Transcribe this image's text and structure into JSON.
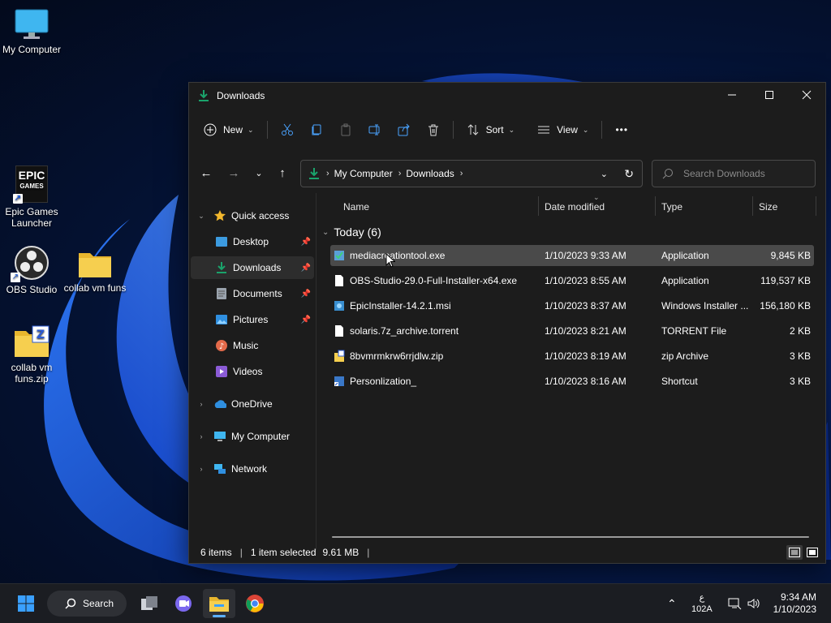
{
  "desktop": {
    "icons": [
      {
        "label": "My Computer"
      },
      {
        "label": "Epic Games Launcher"
      },
      {
        "label": "OBS Studio"
      },
      {
        "label": "collab vm funs"
      },
      {
        "label": "collab vm funs.zip"
      }
    ],
    "epic_logo_text": [
      "EPIC",
      "GAMES"
    ]
  },
  "window": {
    "title": "Downloads",
    "toolbar": {
      "new_label": "New",
      "sort_label": "Sort",
      "view_label": "View",
      "more_label": "•••"
    },
    "address": {
      "crumbs": [
        "My Computer",
        "Downloads"
      ]
    },
    "search": {
      "placeholder": "Search Downloads"
    },
    "nav": {
      "quick_access": "Quick access",
      "items": [
        {
          "label": "Desktop",
          "pinned": true
        },
        {
          "label": "Downloads",
          "pinned": true,
          "selected": true
        },
        {
          "label": "Documents",
          "pinned": true
        },
        {
          "label": "Pictures",
          "pinned": true
        },
        {
          "label": "Music",
          "pinned": false
        },
        {
          "label": "Videos",
          "pinned": false
        }
      ],
      "onedrive": "OneDrive",
      "my_computer": "My Computer",
      "network": "Network"
    },
    "columns": {
      "name": "Name",
      "date": "Date modified",
      "type": "Type",
      "size": "Size"
    },
    "group": {
      "label": "Today (6)"
    },
    "files": [
      {
        "name": "mediacreationtool.exe",
        "date": "1/10/2023 9:33 AM",
        "type": "Application",
        "size": "9,845 KB",
        "icon": "installer-icon",
        "selected": true
      },
      {
        "name": "OBS-Studio-29.0-Full-Installer-x64.exe",
        "date": "1/10/2023 8:55 AM",
        "type": "Application",
        "size": "119,537 KB",
        "icon": "blank-file-icon"
      },
      {
        "name": "EpicInstaller-14.2.1.msi",
        "date": "1/10/2023 8:37 AM",
        "type": "Windows Installer ...",
        "size": "156,180 KB",
        "icon": "msi-icon"
      },
      {
        "name": "solaris.7z_archive.torrent",
        "date": "1/10/2023 8:21 AM",
        "type": "TORRENT File",
        "size": "2 KB",
        "icon": "blank-file-icon"
      },
      {
        "name": "8bvmrmkrw6rrjdlw.zip",
        "date": "1/10/2023 8:19 AM",
        "type": "zip Archive",
        "size": "3 KB",
        "icon": "zip-icon"
      },
      {
        "name": "Personlization_",
        "date": "1/10/2023 8:16 AM",
        "type": "Shortcut",
        "size": "3 KB",
        "icon": "shortcut-icon"
      }
    ],
    "status": {
      "items": "6 items",
      "selected": "1 item selected",
      "size": "9.61 MB"
    }
  },
  "taskbar": {
    "search_label": "Search",
    "tray": {
      "lang_top": "ع",
      "lang_bottom": "102A",
      "time": "9:34 AM",
      "date": "1/10/2023"
    }
  },
  "colors": {
    "accent_green": "#1aa36b",
    "folder_yellow": "#f4c542",
    "window_bg": "#1c1c1c",
    "selection": "#4a4a4a"
  }
}
